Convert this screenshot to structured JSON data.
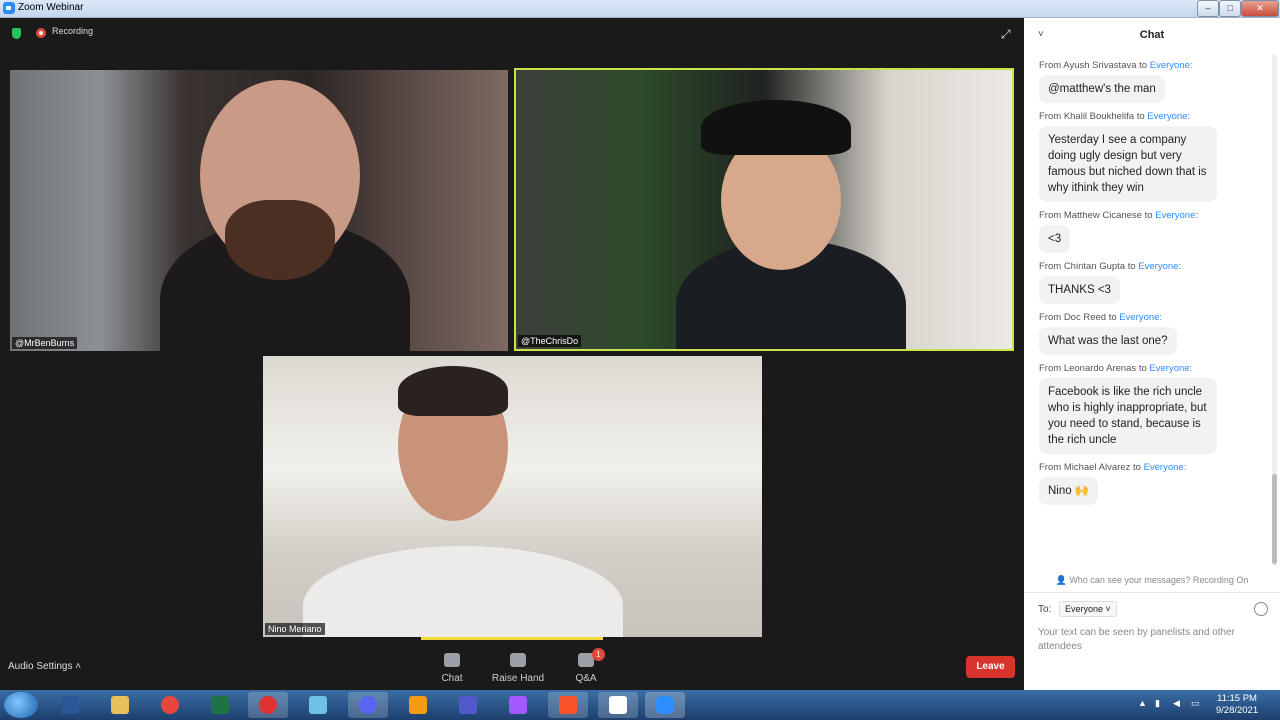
{
  "window": {
    "title": "Zoom Webinar"
  },
  "meeting": {
    "recording_label": "Recording",
    "participants": [
      {
        "name": "@MrBenBurns"
      },
      {
        "name": "@TheChrisDo"
      },
      {
        "name": "Nino Meriano"
      }
    ],
    "controls": {
      "audio_settings": "Audio Settings",
      "chat": "Chat",
      "raise_hand": "Raise Hand",
      "qa": "Q&A",
      "qa_badge": "1",
      "leave": "Leave"
    }
  },
  "chat": {
    "title": "Chat",
    "messages": [
      {
        "from": "Ayush Srivastava",
        "to": "Everyone:",
        "text": "@matthew's the man"
      },
      {
        "from": "Khalil Boukhelifa",
        "to": "Everyone:",
        "text": "Yesterday I see a company doing ugly design but very famous but niched down that is why ithink they win"
      },
      {
        "from": "Matthew Cicanese",
        "to": "Everyone:",
        "text": "<3"
      },
      {
        "from": "Chintan Gupta",
        "to": "Everyone:",
        "text": "THANKS <3"
      },
      {
        "from": "Doc Reed",
        "to": "Everyone:",
        "text": "What was the last one?"
      },
      {
        "from": "Leonardo Arenas",
        "to": "Everyone:",
        "text": "Facebook is like the rich uncle who is highly inappropriate, but you need to stand, because is the rich uncle"
      },
      {
        "from": "Michael Alvarez",
        "to": "Everyone:",
        "text": "Nino 🙌"
      }
    ],
    "from_prefix": "From",
    "to_word": "to",
    "visibility_notice": "Who can see your messages? Recording On",
    "to_label": "To:",
    "to_value": "Everyone",
    "input_hint": "Your text can be seen by panelists and other attendees"
  },
  "taskbar": {
    "time": "11:15 PM",
    "date": "9/28/2021"
  }
}
